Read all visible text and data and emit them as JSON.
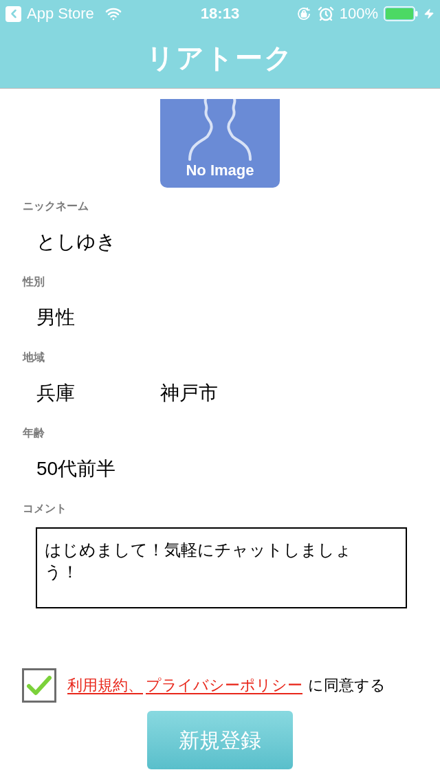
{
  "status_bar": {
    "back_label": "App Store",
    "time": "18:13",
    "battery": "100%"
  },
  "nav_bar": {
    "title": "リアトーク"
  },
  "avatar": {
    "caption": "No Image"
  },
  "fields": [
    {
      "kind": "single",
      "label": "ニックネーム",
      "values": [
        "としゆき"
      ]
    },
    {
      "kind": "single",
      "label": "性別",
      "values": [
        "男性"
      ]
    },
    {
      "kind": "pair",
      "label": "地域",
      "values": [
        "兵庫",
        "神戸市"
      ]
    },
    {
      "kind": "single",
      "label": "年齢",
      "values": [
        "50代前半"
      ]
    }
  ],
  "comment": {
    "label": "コメント",
    "value": "はじめまして！気軽にチャットしましょう！"
  },
  "agreement": {
    "checked": true,
    "links": [
      "利用規約、",
      "プライバシーポリシー"
    ],
    "text": "に同意する"
  },
  "submit_button": {
    "label": "新規登録"
  }
}
